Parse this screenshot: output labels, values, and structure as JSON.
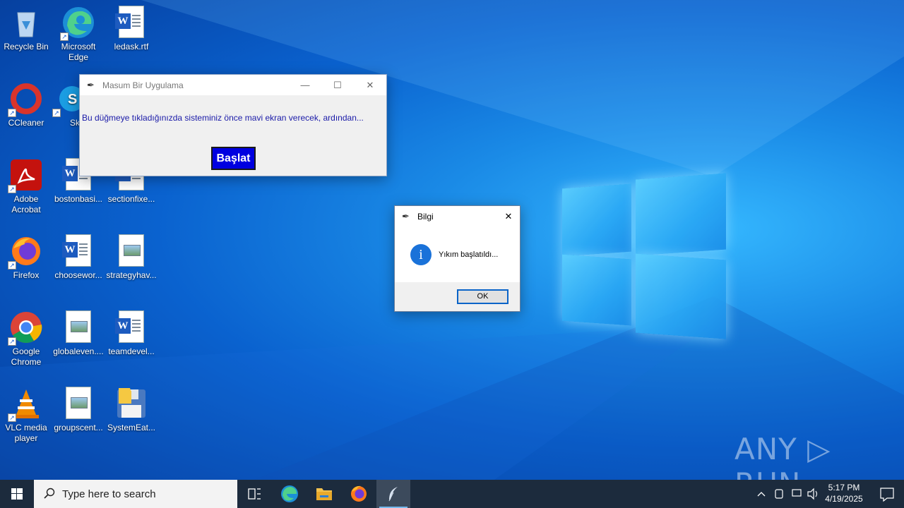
{
  "desktop": {
    "icons": [
      {
        "label": "Recycle Bin"
      },
      {
        "label": "Microsoft Edge"
      },
      {
        "label": "ledask.rtf"
      },
      {
        "label": "CCleaner"
      },
      {
        "label": "Sky"
      },
      {
        "label": "Adobe Acrobat"
      },
      {
        "label": "bostonbasi..."
      },
      {
        "label": "sectionfixe..."
      },
      {
        "label": "Firefox"
      },
      {
        "label": "choosewor..."
      },
      {
        "label": "strategyhav..."
      },
      {
        "label": "Google Chrome"
      },
      {
        "label": "globaleven...."
      },
      {
        "label": "teamdevel..."
      },
      {
        "label": "VLC media player"
      },
      {
        "label": "groupscent..."
      },
      {
        "label": "SystemEat..."
      }
    ]
  },
  "main_window": {
    "title": "Masum Bir Uygulama",
    "message": "Bu düğmeye tıkladığınızda sisteminiz önce mavi ekran verecek, ardından...",
    "button_label": "Başlat",
    "minimize_glyph": "—",
    "maximize_glyph": "☐",
    "close_glyph": "✕"
  },
  "dialog": {
    "title": "Bilgi",
    "message": "Yıkım başlatıldı...",
    "ok_label": "OK",
    "close_glyph": "✕",
    "icon_glyph": "i"
  },
  "watermark": {
    "text": "ANY ▷ RUN"
  },
  "taskbar": {
    "search_placeholder": "Type here to search",
    "time": "5:17 PM",
    "date": "4/19/2025"
  },
  "colors": {
    "accent_button": "#0000e0",
    "message_text": "#1a1aa8",
    "taskbar": "#1c2b3d"
  }
}
